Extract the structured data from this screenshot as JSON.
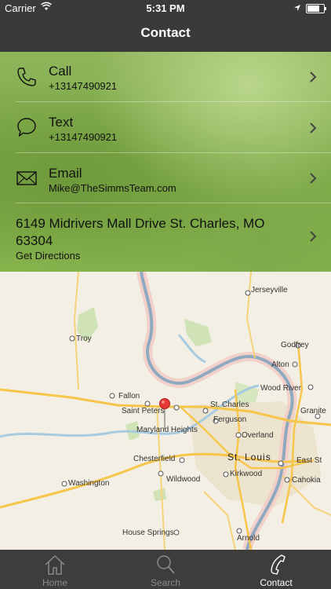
{
  "status_bar": {
    "carrier": "Carrier",
    "time": "5:31 PM"
  },
  "nav": {
    "title": "Contact"
  },
  "contact": {
    "call": {
      "title": "Call",
      "detail": "+13147490921",
      "icon": "phone-icon"
    },
    "text": {
      "title": "Text",
      "detail": "+13147490921",
      "icon": "speech-bubble-icon"
    },
    "email": {
      "title": "Email",
      "detail": "Mike@TheSimmsTeam.com",
      "icon": "envelope-icon"
    },
    "address": {
      "line": "6149 Midrivers Mall Drive St. Charles, MO 63304",
      "action": "Get Directions"
    }
  },
  "map": {
    "labels": {
      "jerseyville": "Jerseyville",
      "troy": "Troy",
      "godfrey": "Godfrey",
      "alton": "Alton",
      "wood_river": "Wood River",
      "fallon": "Fallon",
      "saint_peters": "Saint Peters",
      "st_charles": "St. Charles",
      "maryland_heights": "Maryland Heights",
      "ferguson": "Ferguson",
      "granite": "Granite",
      "overland": "Overland",
      "chesterfield": "Chesterfield",
      "st_louis": "St. Louis",
      "east_st": "East St",
      "wildwood": "Wildwood",
      "kirkwood": "Kirkwood",
      "washington": "Washington",
      "cahokia": "Cahokia",
      "house_springs": "House Springs",
      "arnold": "Arnold"
    }
  },
  "tabs": [
    {
      "label": "Home",
      "icon": "home-icon",
      "active": false
    },
    {
      "label": "Search",
      "icon": "search-icon",
      "active": false
    },
    {
      "label": "Contact",
      "icon": "phone-icon",
      "active": true
    }
  ]
}
